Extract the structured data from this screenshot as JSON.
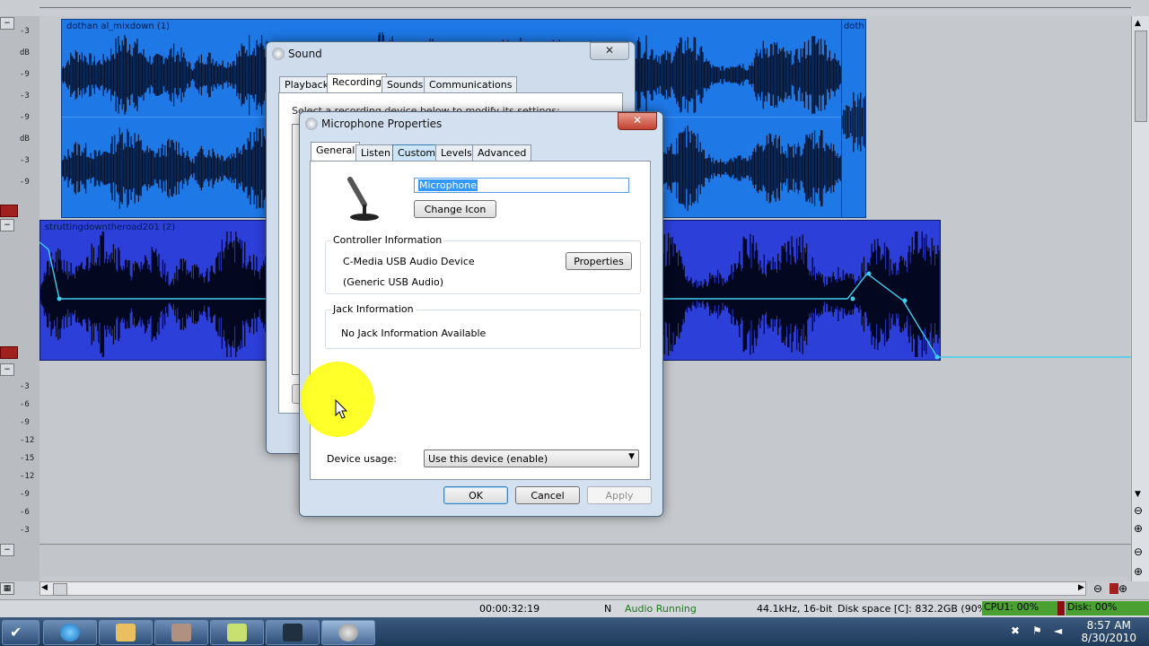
{
  "daw": {
    "track1_clip_name": "dothan al_mixdown (1)",
    "track1_clip2_name": "doth",
    "track2_clip_name": "struttingdowntheroad201 (2)",
    "meter_labels_a": [
      "-3",
      "dB",
      "-9",
      "-3",
      "-9",
      "dB",
      "-3",
      "-9"
    ],
    "meter_labels_b": [
      "-3",
      "-6",
      "-9",
      "-12",
      "-15",
      "-12",
      "-9",
      "-6",
      "-3"
    ],
    "colors": {
      "clip_blue": "#1e78e6",
      "clip_purple": "#2c3fd9",
      "envelope": "#3fd0f0"
    }
  },
  "status": {
    "time": "00:00:32:19",
    "mode": "N",
    "audio_state": "Audio Running",
    "format": "44.1kHz, 16-bit",
    "disk_space": "Disk space [C]: 832.2GB (90%)",
    "cpu1": "CPU1: 00%",
    "disk": "Disk: 00%"
  },
  "taskbar": {
    "clock_time": "8:57 AM",
    "clock_date": "8/30/2010",
    "buttons": [
      "start-orb",
      "ie",
      "explorer",
      "photo",
      "notes",
      "media",
      "sound"
    ]
  },
  "sound_dialog": {
    "title": "Sound",
    "close": "✕",
    "tabs": [
      "Playback",
      "Recording",
      "Sounds",
      "Communications"
    ],
    "active_tab": "Recording",
    "instruction": "Select a recording device below to modify its settings:"
  },
  "mic_dialog": {
    "title": "Microphone Properties",
    "close": "✕",
    "tabs": [
      "General",
      "Listen",
      "Custom",
      "Levels",
      "Advanced"
    ],
    "active_tab": "General",
    "device_name": "Microphone",
    "change_icon": "Change Icon",
    "controller_title": "Controller Information",
    "controller_name": "C-Media USB Audio Device",
    "controller_sub": "(Generic USB Audio)",
    "properties_btn": "Properties",
    "jack_title": "Jack Information",
    "jack_text": "No Jack Information Available",
    "device_usage_label": "Device usage:",
    "device_usage_value": "Use this device (enable)",
    "ok": "OK",
    "cancel": "Cancel",
    "apply": "Apply"
  }
}
